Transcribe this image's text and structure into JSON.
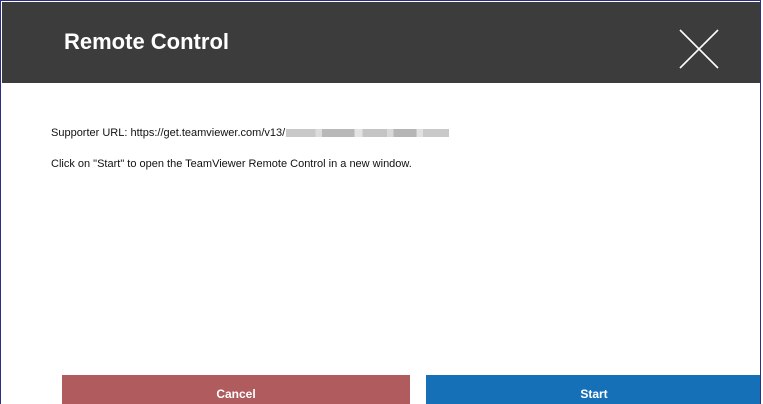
{
  "dialog": {
    "title": "Remote Control",
    "close_icon": "close-icon"
  },
  "content": {
    "url_label": "Supporter URL: https://get.teamviewer.com/v13/",
    "instruction": "Click on \"Start\" to open the TeamViewer Remote Control in a new window."
  },
  "buttons": {
    "cancel_label": "Cancel",
    "start_label": "Start"
  },
  "colors": {
    "header_bg": "#3c3c3c",
    "cancel_bg": "#b05b5e",
    "start_bg": "#1570b8"
  }
}
